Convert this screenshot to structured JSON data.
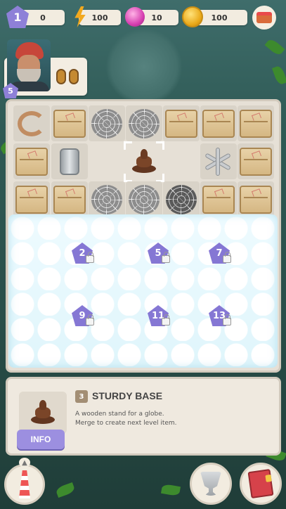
{
  "topbar": {
    "player_level": "1",
    "xp_value": "0",
    "energy_value": "100",
    "gems_value": "10",
    "coins_value": "100"
  },
  "quest": {
    "level": "5",
    "character": "old-sailor-portrait",
    "required_item": "binoculars-icon"
  },
  "board": {
    "fog_locks": [
      "2",
      "5",
      "7",
      "9",
      "11",
      "13"
    ]
  },
  "info_panel": {
    "item_level": "3",
    "item_name": "STURDY BASE",
    "description_line1": "A wooden stand for a globe.",
    "description_line2": "Merge to create next level item.",
    "info_button_label": "INFO"
  },
  "colors": {
    "accent_purple": "#8e80d8",
    "board_bg": "#e6e0d6",
    "fog": "#eefbff"
  }
}
